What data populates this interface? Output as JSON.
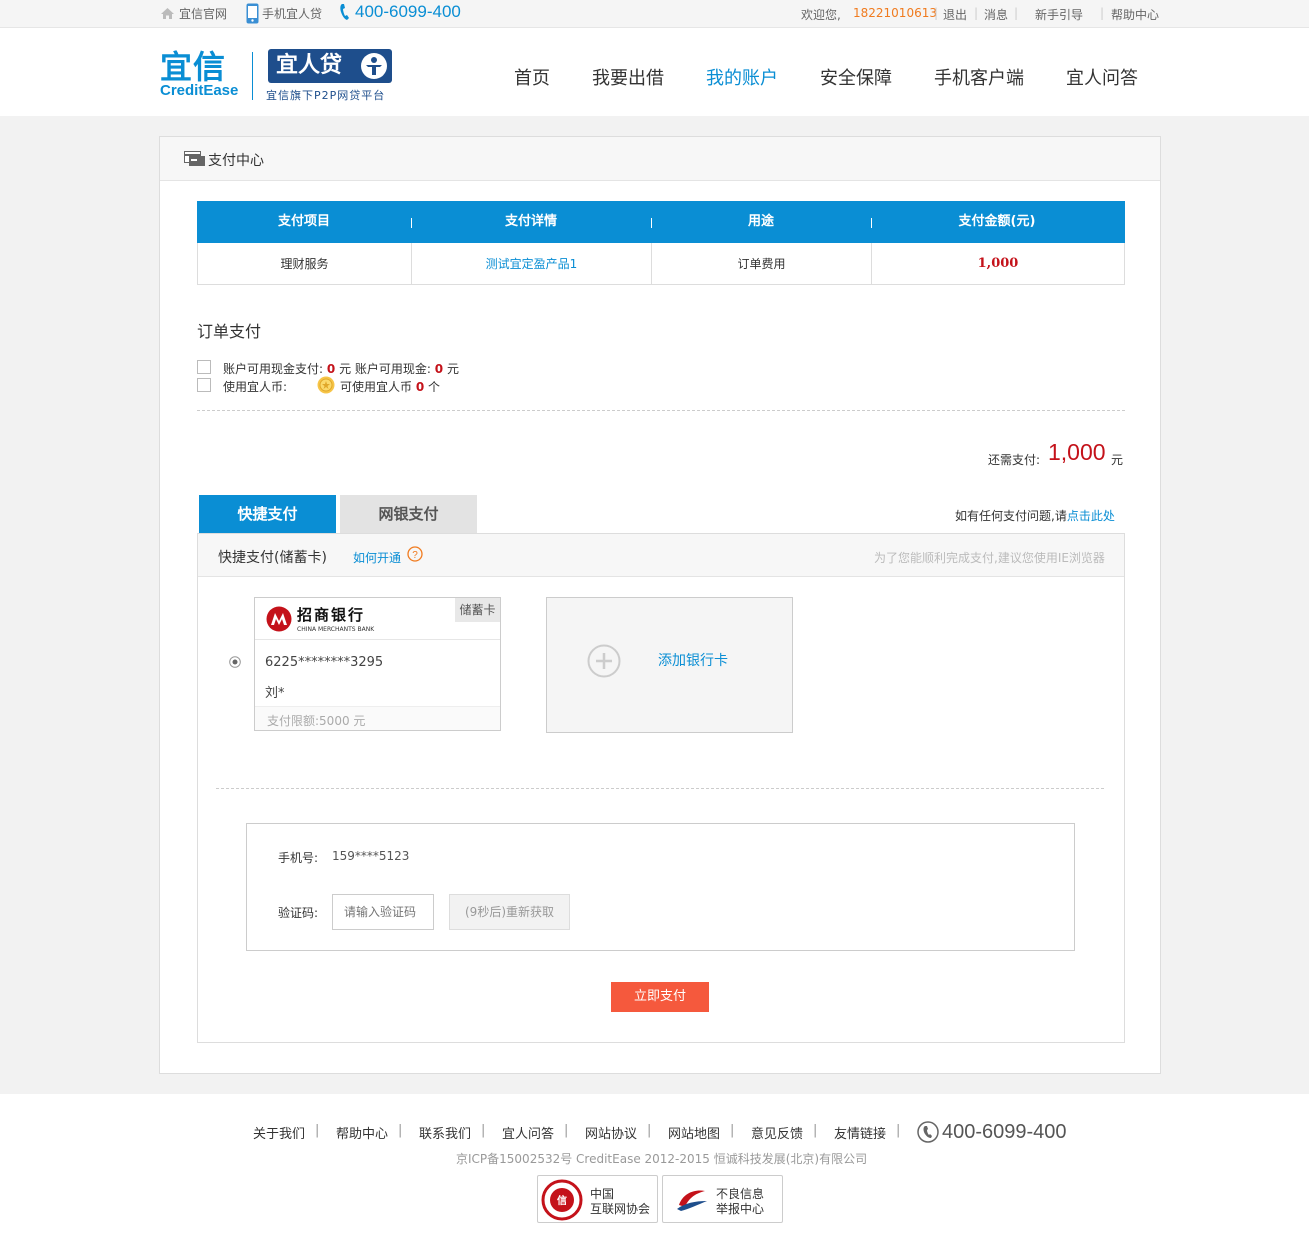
{
  "topbar": {
    "official_site": "宜信官网",
    "mobile_app": "手机宜人贷",
    "phone": "400-6099-400",
    "welcome": "欢迎您,",
    "username": "18221010613",
    "logout": "退出",
    "messages": "消息",
    "guide": "新手引导",
    "help": "帮助中心"
  },
  "header": {
    "logo_cn": "宜信",
    "logo_en": "CreditEase",
    "logo2": "宜人贷",
    "logo2_sub": "宜信旗下P2P网贷平台",
    "nav": [
      "首页",
      "我要出借",
      "我的账户",
      "安全保障",
      "手机客户端",
      "宜人问答"
    ]
  },
  "panel": {
    "title": "支付中心"
  },
  "order_table": {
    "headers": [
      "支付项目",
      "支付详情",
      "用途",
      "支付金额(元)"
    ],
    "row": [
      "理财服务",
      "测试宜定盈产品1",
      "订单费用",
      "1,000"
    ]
  },
  "order_pay": {
    "title": "订单支付",
    "cash_label": "账户可用现金支付:",
    "cash_value": "0",
    "cash_unit": "元",
    "cash_avail_label": "账户可用现金:",
    "cash_avail_value": "0",
    "cash_avail_unit": "元",
    "coin_label": "使用宜人币:",
    "coin_avail_label": "可使用宜人币",
    "coin_avail_value": "0",
    "coin_unit": "个",
    "due_label": "还需支付:",
    "due_value": "1,000",
    "due_unit": "元"
  },
  "tabs": {
    "quick": "快捷支付",
    "netbank": "网银支付",
    "help_prefix": "如有任何支付问题,请",
    "help_link": "点击此处"
  },
  "quick_pay": {
    "title": "快捷支付(储蓄卡)",
    "how_to": "如何开通",
    "hint": "为了您能顺利完成支付,建议您使用IE浏览器",
    "card_bank_cn": "招商银行",
    "card_bank_en": "CHINA MERCHANTS BANK",
    "card_type": "储蓄卡",
    "card_number": "6225********3295",
    "card_holder": "刘*",
    "card_limit": "支付限额:5000 元",
    "add_card": "添加银行卡",
    "phone_label": "手机号:",
    "phone_value": "159****5123",
    "code_label": "验证码:",
    "code_placeholder": "请输入验证码",
    "resend": "(9秒后)重新获取",
    "pay_button": "立即支付"
  },
  "footer": {
    "links": [
      "关于我们",
      "帮助中心",
      "联系我们",
      "宜人问答",
      "网站协议",
      "网站地图",
      "意见反馈",
      "友情链接"
    ],
    "phone": "400-6099-400",
    "icp": "京ICP备15002532号 CreditEase 2012-2015 恒诚科技发展(北京)有限公司",
    "badge1_line1": "中国",
    "badge1_line2": "互联网协会",
    "badge2_line1": "不良信息",
    "badge2_line2": "举报中心"
  },
  "colors": {
    "brand": "#0a8ed4",
    "price_red": "#c4121a",
    "pay_button": "#f5593d",
    "username": "#f07b1f"
  }
}
